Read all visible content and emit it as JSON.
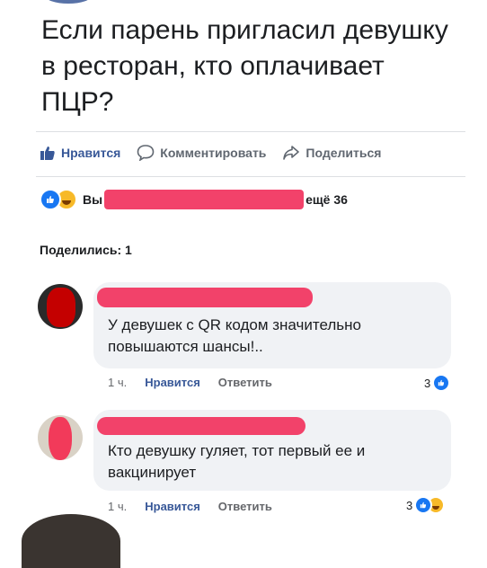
{
  "post": {
    "text_lines": [
      "Если парень пригласил девушку",
      "в ресторан, кто оплачивает",
      "ПЦР?"
    ]
  },
  "actions": {
    "like": "Нравится",
    "comment": "Комментировать",
    "share": "Поделиться"
  },
  "reactions": {
    "prefix": "Вы",
    "suffix": "ещё 36"
  },
  "shares_label": "Поделились: 1",
  "comments": [
    {
      "text_lines": [
        "У девушек с QR кодом  значительно",
        "повышаются шансы!.."
      ],
      "time": "1 ч.",
      "like": "Нравится",
      "reply": "Ответить",
      "reaction_count": "3"
    },
    {
      "text_lines": [
        "Кто девушку гуляет, тот первый ее и",
        "вакцинирует"
      ],
      "time": "1 ч.",
      "like": "Нравится",
      "reply": "Ответить",
      "reaction_count": "3"
    }
  ],
  "colors": {
    "redaction": "#f2426a",
    "facebook_blue": "#1877f2",
    "link_blue": "#385898"
  }
}
